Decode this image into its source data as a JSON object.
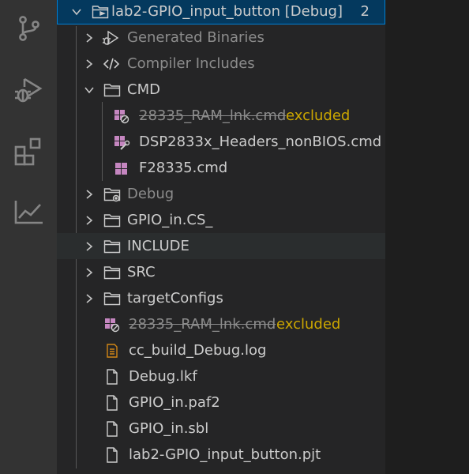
{
  "activity_bar": {
    "icons": [
      "source-control-icon",
      "run-debug-icon",
      "extensions-icon",
      "chart-icon"
    ]
  },
  "tree": {
    "project": {
      "label": "lab2-GPIO_input_button  [Debug]",
      "count": "2"
    },
    "items": [
      {
        "label": "Generated Binaries"
      },
      {
        "label": "Compiler Includes"
      },
      {
        "label": "CMD"
      },
      {
        "label": "28335_RAM_lnk.cmd",
        "decoration": "excluded"
      },
      {
        "label": "DSP2833x_Headers_nonBIOS.cmd"
      },
      {
        "label": "F28335.cmd"
      },
      {
        "label": "Debug"
      },
      {
        "label": "GPIO_in.CS_"
      },
      {
        "label": "INCLUDE"
      },
      {
        "label": "SRC"
      },
      {
        "label": "targetConfigs"
      },
      {
        "label": "28335_RAM_lnk.cmd",
        "decoration": "excluded"
      },
      {
        "label": "cc_build_Debug.log"
      },
      {
        "label": "Debug.lkf"
      },
      {
        "label": "GPIO_in.paf2"
      },
      {
        "label": "GPIO_in.sbl"
      },
      {
        "label": "lab2-GPIO_input_button.pjt"
      }
    ]
  },
  "colors": {
    "selection_bg": "#04395e",
    "selection_border": "#007fd4",
    "excluded_text": "#cca700",
    "cmd_icon": "#c586c0",
    "log_icon": "#d18616"
  }
}
